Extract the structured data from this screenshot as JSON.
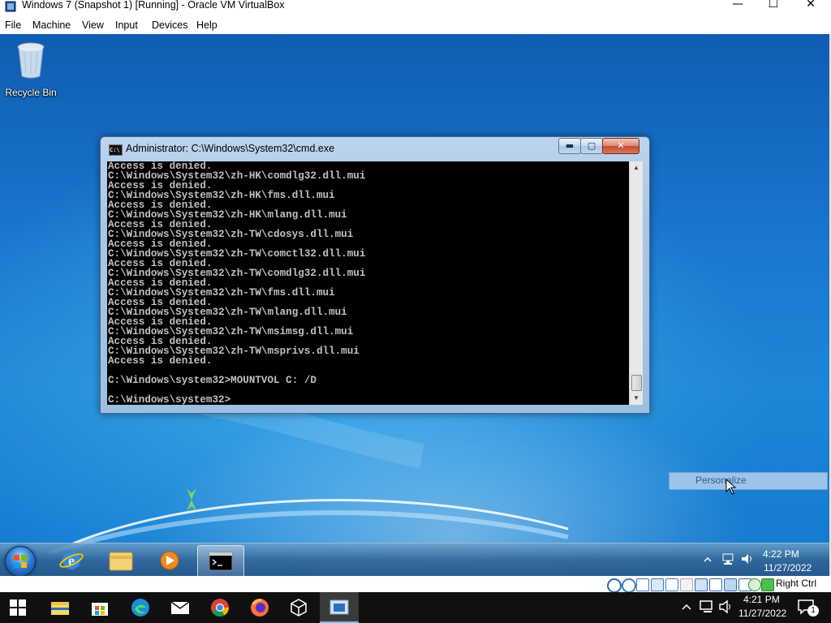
{
  "host_window": {
    "title": "Windows 7 (Snapshot 1) [Running] - Oracle VM VirtualBox",
    "controls": {
      "minimize": "—",
      "maximize": "☐",
      "close": "✕"
    },
    "menu": [
      "File",
      "Machine",
      "View",
      "Input",
      "Devices",
      "Help"
    ]
  },
  "guest_desktop": {
    "icons": [
      {
        "label": "Recycle Bin",
        "icon": "recycle-bin-icon"
      }
    ],
    "cmd_window": {
      "title": "Administrator: C:\\Windows\\System32\\cmd.exe",
      "icon_text": "C:\\",
      "buttons": {
        "minimize": "▬",
        "maximize": "▢",
        "close": "✕"
      },
      "console_text": "Access is denied.\nC:\\Windows\\System32\\zh-HK\\comdlg32.dll.mui\nAccess is denied.\nC:\\Windows\\System32\\zh-HK\\fms.dll.mui\nAccess is denied.\nC:\\Windows\\System32\\zh-HK\\mlang.dll.mui\nAccess is denied.\nC:\\Windows\\System32\\zh-TW\\cdosys.dll.mui\nAccess is denied.\nC:\\Windows\\System32\\zh-TW\\comctl32.dll.mui\nAccess is denied.\nC:\\Windows\\System32\\zh-TW\\comdlg32.dll.mui\nAccess is denied.\nC:\\Windows\\System32\\zh-TW\\fms.dll.mui\nAccess is denied.\nC:\\Windows\\System32\\zh-TW\\mlang.dll.mui\nAccess is denied.\nC:\\Windows\\System32\\zh-TW\\msimsg.dll.mui\nAccess is denied.\nC:\\Windows\\System32\\zh-TW\\msprivs.dll.mui\nAccess is denied.\n\nC:\\Windows\\system32>MOUNTVOL C: /D\n\nC:\\Windows\\system32>"
    },
    "context_menu": {
      "item": "Personalize"
    },
    "taskbar": {
      "pinned": [
        "start-orb",
        "internet-explorer-icon",
        "windows-explorer-icon",
        "media-player-icon",
        "cmd-taskbar-icon"
      ],
      "time": "4:22 PM",
      "date": "11/27/2022"
    }
  },
  "vbox_statusbar": {
    "host_key": "Right Ctrl"
  },
  "host_taskbar": {
    "apps": [
      "start-button-icon",
      "file-explorer-icon",
      "store-icon",
      "edge-icon",
      "mail-icon",
      "chrome-icon",
      "firefox-icon",
      "virtualbox-icon",
      "vm-window-icon"
    ],
    "time": "4:21 PM",
    "date": "11/27/2022",
    "notifications": "1"
  },
  "colors": {
    "guest_desktop": "#1a78cf",
    "console_bg": "#000000",
    "console_fg": "#c0c0c0",
    "host_taskbar": "#101010"
  }
}
